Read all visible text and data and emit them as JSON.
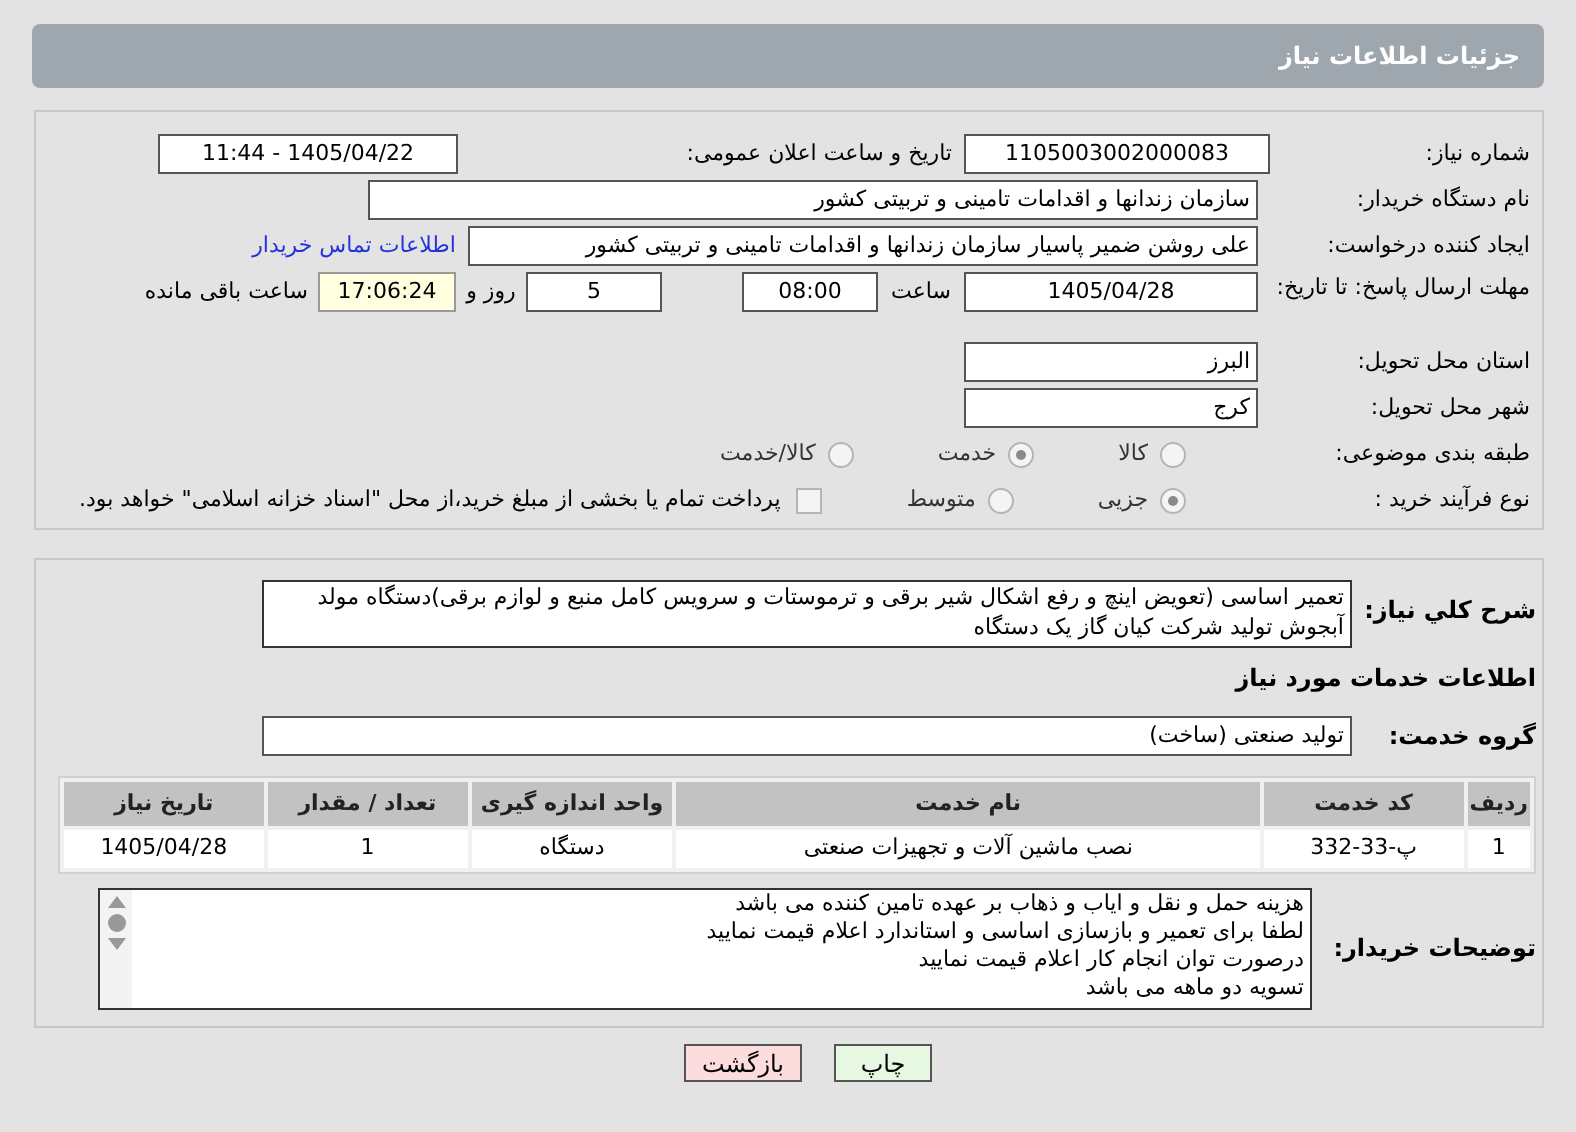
{
  "header": {
    "title": "جزئیات اطلاعات نیاز"
  },
  "need_number": {
    "label": "شماره نیاز:",
    "value": "1105003002000083"
  },
  "announce": {
    "label": "تاریخ و ساعت اعلان عمومی:",
    "value": "1405/04/22 - 11:44"
  },
  "buyer_org": {
    "label": "نام دستگاه خریدار:",
    "value": "سازمان زندانها و اقدامات تامینی و تربیتی کشور"
  },
  "requester": {
    "label": "ایجاد کننده درخواست:",
    "value": "علی روشن ضمیر پاسیار سازمان زندانها و اقدامات تامینی و تربیتی کشور",
    "link": "اطلاعات تماس خریدار"
  },
  "deadline": {
    "label": "مهلت ارسال پاسخ: تا تاریخ:",
    "date": "1405/04/28",
    "time_label": "ساعت",
    "time": "08:00",
    "days": "5",
    "days_label": "روز و",
    "remaining": "17:06:24",
    "remaining_label": "ساعت باقی مانده"
  },
  "province": {
    "label": "استان محل تحویل:",
    "value": "البرز"
  },
  "city": {
    "label": "شهر محل تحویل:",
    "value": "کرج"
  },
  "category": {
    "label": "طبقه بندی موضوعی:",
    "options": [
      {
        "label": "کالا",
        "selected": false
      },
      {
        "label": "خدمت",
        "selected": true
      },
      {
        "label": "کالا/خدمت",
        "selected": false
      }
    ]
  },
  "process": {
    "label": "نوع فرآیند خرید :",
    "options": [
      {
        "label": "جزیی",
        "selected": true
      },
      {
        "label": "متوسط",
        "selected": false
      }
    ],
    "checkbox": {
      "label": "پرداخت تمام یا بخشی از مبلغ خرید،از محل \"اسناد خزانه اسلامی\" خواهد بود.",
      "checked": false
    }
  },
  "description": {
    "label": "شرح کلي نياز:",
    "text": "تعمیر اساسی (تعویض اینچ و رفع اشکال شیر برقی و ترموستات و سرویس کامل منبع و لوازم برقی)دستگاه مولد آبجوش تولید شرکت کیان گاز یک دستگاه"
  },
  "services_heading": "اطلاعات خدمات مورد نیاز",
  "service_group": {
    "label": "گروه خدمت:",
    "value": "تولید صنعتی (ساخت)"
  },
  "table": {
    "columns": [
      "ردیف",
      "کد خدمت",
      "نام خدمت",
      "واحد اندازه گیری",
      "تعداد / مقدار",
      "تاریخ نیاز"
    ],
    "rows": [
      [
        "1",
        "پ-33-332",
        "نصب ماشین آلات و تجهیزات صنعتی",
        "دستگاه",
        "1",
        "1405/04/28"
      ]
    ]
  },
  "buyer_notes": {
    "label": "توضیحات خریدار:",
    "lines": [
      "هزینه حمل و نقل و ایاب و ذهاب بر عهده تامین کننده می باشد",
      "لطفا برای تعمیر و بازسازی اساسی و استاندارد اعلام قیمت نمایید",
      "درصورت توان انجام کار اعلام قیمت نمایید",
      "تسویه دو ماهه می باشد"
    ]
  },
  "buttons": [
    {
      "label": "چاپ",
      "kind": "print"
    },
    {
      "label": "بازگشت",
      "kind": "back"
    }
  ]
}
